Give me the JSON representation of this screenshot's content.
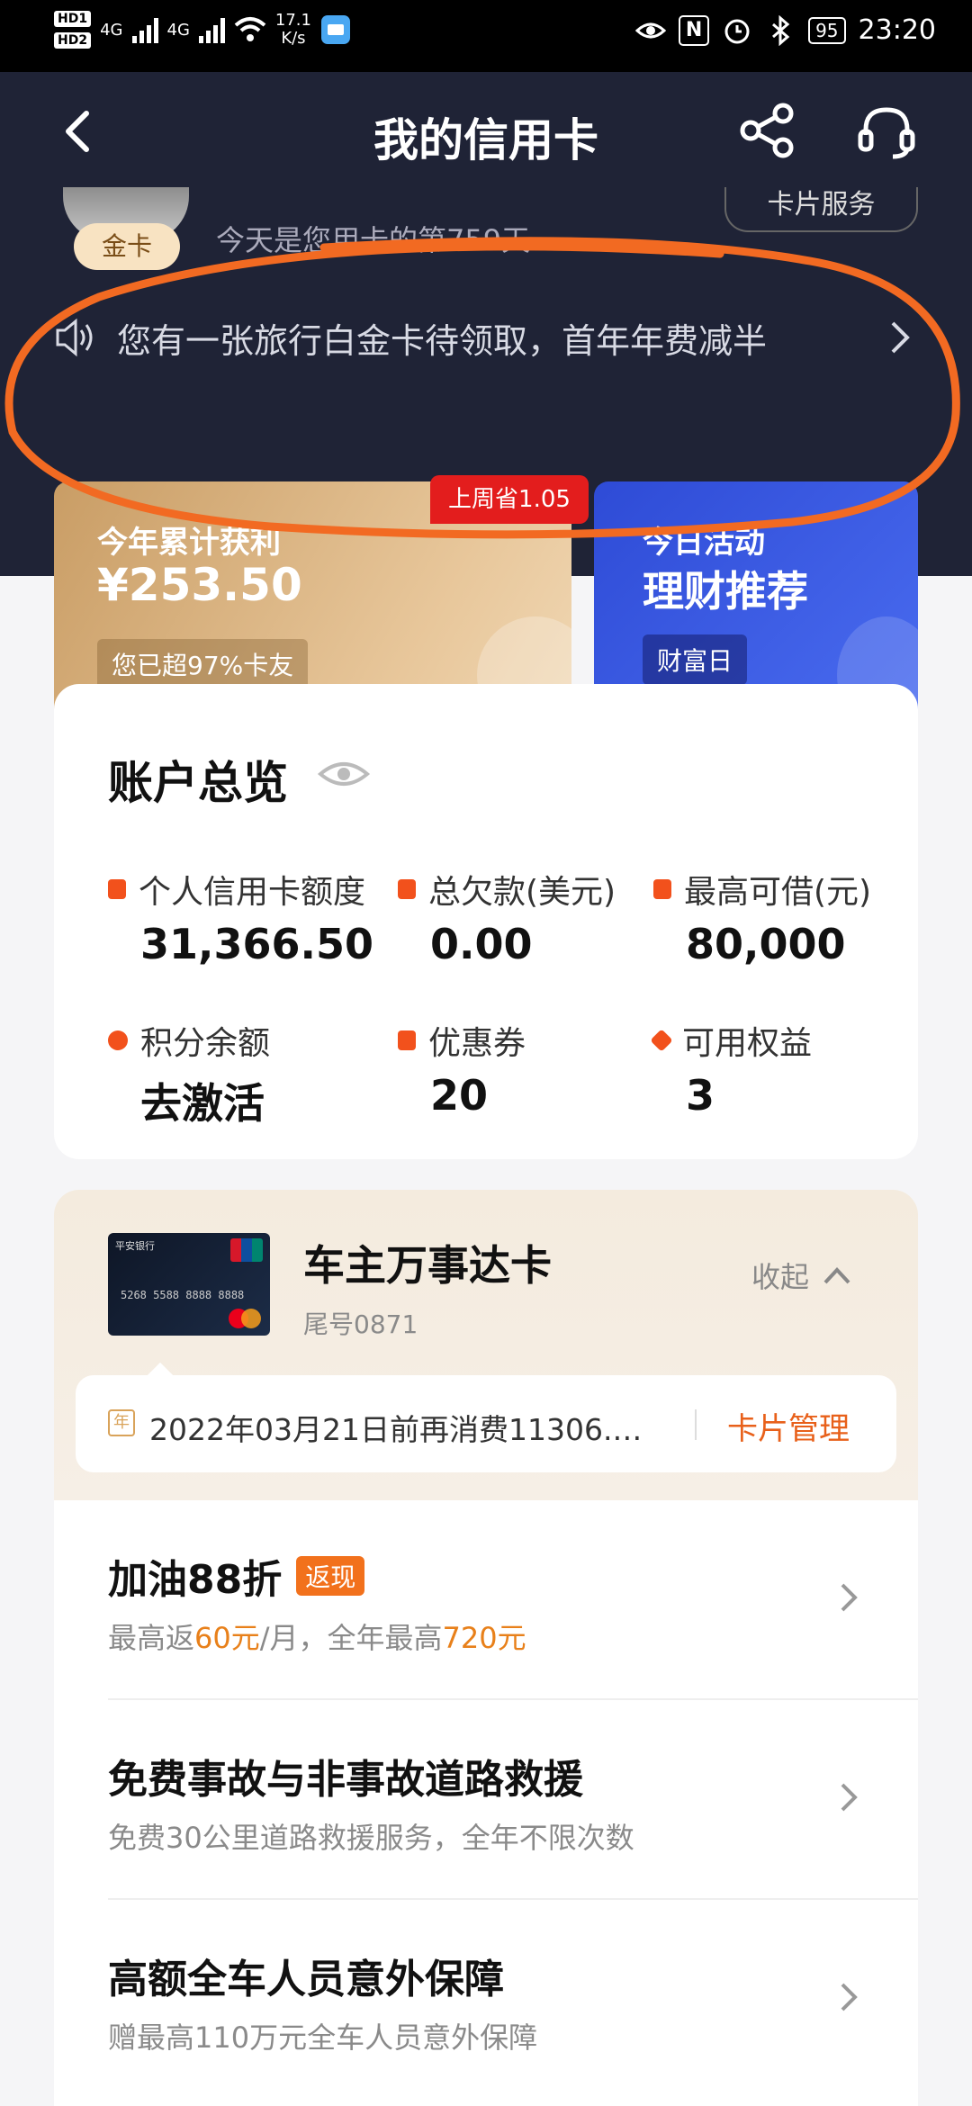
{
  "status_bar": {
    "hd1": "HD1",
    "hd2": "HD2",
    "net1": "4G",
    "net2": "4G",
    "speed_value": "17.1",
    "speed_unit": "K/s",
    "nfc": "N",
    "battery": "95",
    "time": "23:20"
  },
  "nav": {
    "title": "我的信用卡"
  },
  "user": {
    "badge": "金卡",
    "days_text": "今天是您用卡的第759天",
    "card_service": "卡片服务"
  },
  "notice": {
    "text": "您有一张旅行白金卡待领取，首年年费减半"
  },
  "profit_card": {
    "label": "今年累计获利",
    "amount": "¥253.50",
    "rank": "您已超97%卡友",
    "save_badge": "上周省1.05"
  },
  "activity_card": {
    "label": "今日活动",
    "title": "理财推荐",
    "tag": "财富日"
  },
  "overview": {
    "title": "账户总览",
    "stats": [
      {
        "label": "个人信用卡额度",
        "value": "31,366.50"
      },
      {
        "label": "总欠款(美元)",
        "value": "0.00"
      },
      {
        "label": "最高可借(元)",
        "value": "80,000"
      },
      {
        "label": "积分余额",
        "value": "去激活"
      },
      {
        "label": "优惠券",
        "value": "20"
      },
      {
        "label": "可用权益",
        "value": "3"
      }
    ]
  },
  "card": {
    "name": "车主万事达卡",
    "tail": "尾号0871",
    "collapse": "收起",
    "image_bank": "平安银行",
    "image_number": "5268 5588 8888 8888",
    "year_icon": "年",
    "notice_text": "2022年03月21日前再消费11306.…",
    "manage": "卡片管理"
  },
  "benefits": [
    {
      "title": "加油88折",
      "tag": "返现",
      "sub_parts": [
        "最高返",
        "60元",
        "/月，全年最高",
        "720元"
      ]
    },
    {
      "title": "免费事故与非事故道路救援",
      "sub": "免费30公里道路救援服务，全年不限次数"
    },
    {
      "title": "高额全车人员意外保障",
      "sub": "赠最高110万元全车人员意外保障"
    }
  ],
  "colors": {
    "header_bg": "#1f2336",
    "accent_orange": "#e8601a",
    "annotation_orange": "#f26a22",
    "activity_blue": "#2e4bd6",
    "badge_red": "#e31d1d"
  }
}
